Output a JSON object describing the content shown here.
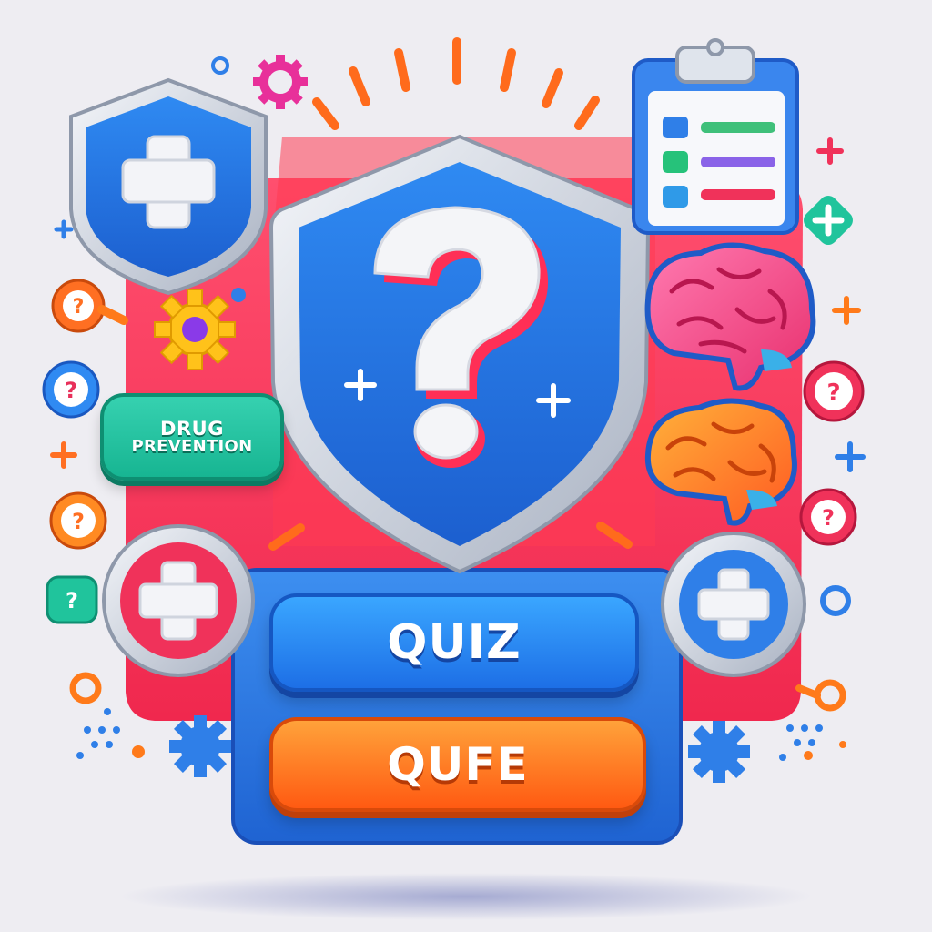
{
  "badge": {
    "line1": "DRUG",
    "line2": "PREVENTION"
  },
  "buttons": {
    "primary_label": "QUIZ",
    "secondary_label": "QUFE"
  },
  "icons": [
    "shield-plus-icon",
    "shield-question-icon",
    "clipboard-checklist-icon",
    "brain-icon",
    "gear-icon",
    "question-bubble-icon",
    "plus-icon"
  ],
  "colors": {
    "background": "#eeedf2",
    "shield_blue": "#2f7fe8",
    "accent_red": "#f0325a",
    "accent_orange": "#ff6a1a",
    "accent_teal": "#20c49c",
    "panel_blue": "#2a7ce0"
  }
}
